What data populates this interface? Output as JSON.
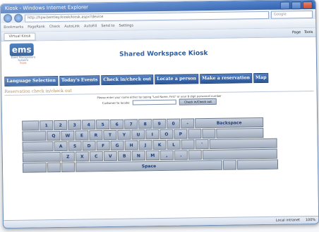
{
  "window": {
    "title": "Kiosk - Windows Internet Explorer"
  },
  "address": {
    "url": "http://hpw.bentley/kiosk/kiosk.aspx?device",
    "search_placeholder": "Google"
  },
  "toolbar": {
    "items": [
      "Bookmarks",
      "PageRank",
      "Check",
      "AutoLink",
      "AutoFill",
      "Send to",
      "Settings"
    ]
  },
  "tabs": {
    "tab1": "Virtual Kiosk",
    "page": "Page",
    "tools": "Tools"
  },
  "header": {
    "logo_text": "ems",
    "logo_sub": "Event Management Systems",
    "logo_sub2": "Kiosk",
    "title": "Shared Workspace Kiosk"
  },
  "nav": [
    {
      "label": "Language Selection"
    },
    {
      "label": "Today's Events"
    },
    {
      "label": "Check in/check out"
    },
    {
      "label": "Locate a person"
    },
    {
      "label": "Make a reservation"
    },
    {
      "label": "Map"
    }
  ],
  "section": {
    "title": "Reservation check in/check out"
  },
  "form": {
    "instruction": "Please enter your name either by typing \"Last Name, First\" or your 8 digit personnel number",
    "label": "Customer to locate:",
    "input_value": "",
    "button_label": "Check in/Check out"
  },
  "keyboard": {
    "row1": [
      " ",
      "1",
      "2",
      "3",
      "4",
      "5",
      "6",
      "7",
      "8",
      "9",
      "0",
      "-",
      "Backspace"
    ],
    "row2": [
      " ",
      "Q",
      "W",
      "E",
      "R",
      "T",
      "Y",
      "U",
      "I",
      "O",
      "P",
      " ",
      " ",
      " "
    ],
    "row3": [
      " ",
      "A",
      "S",
      "D",
      "F",
      "G",
      "H",
      "J",
      "K",
      "L",
      " ",
      "'",
      " "
    ],
    "row4": [
      " ",
      "Z",
      "X",
      "C",
      "V",
      "B",
      "N",
      "M",
      ",",
      ".",
      " ",
      " "
    ],
    "row5": [
      "Space"
    ]
  },
  "status": {
    "zone": "Local intranet",
    "zoom": "100%"
  }
}
